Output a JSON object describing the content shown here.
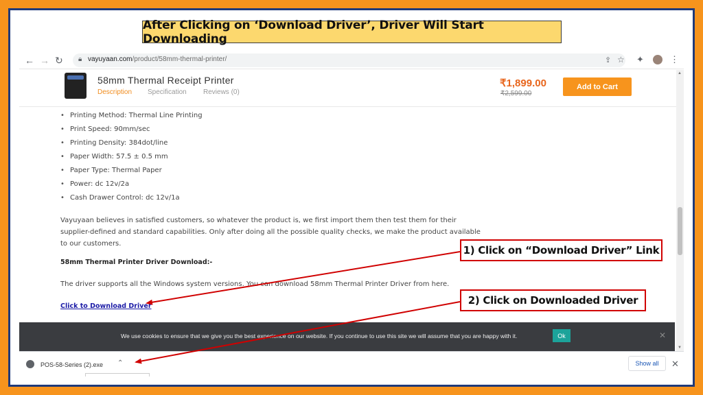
{
  "banner": {
    "title": "After Clicking on ‘Download Driver’, Driver Will Start Downloading"
  },
  "browser": {
    "url_domain": "vayuyaan.com",
    "url_path": "/product/58mm-thermal-printer/"
  },
  "product": {
    "title": "58mm Thermal Receipt Printer",
    "tabs": [
      {
        "label": "Description",
        "active": true
      },
      {
        "label": "Specification",
        "active": false
      },
      {
        "label": "Reviews (0)",
        "active": false
      }
    ],
    "price": "₹1,899.00",
    "old_price": "₹2,599.00",
    "cart_label": "Add to Cart"
  },
  "specs": [
    "Printing Method: Thermal Line Printing",
    "Print Speed: 90mm/sec",
    "Printing Density: 384dot/line",
    "Paper Width: 57.5 ± 0.5 mm",
    "Paper Type: Thermal Paper",
    "Power: dc 12v/2a",
    "Cash Drawer Control: dc 12v/1a"
  ],
  "paragraph": "Vayuyaan believes in satisfied customers, so whatever the product is, we first import them then test them for their supplier-defined and standard capabilities. Only after doing all the possible quality checks, we make the product available to our customers.",
  "download_section": {
    "heading": "58mm Thermal Printer Driver Download:-",
    "description": "The driver supports all the Windows system versions. You can download 58mm Thermal Printer Driver from here.",
    "link_text": "Click to Download Driver"
  },
  "cookie": {
    "text": "We use cookies to ensure that we give you the best experience on our website. If you continue to use this site we will assume that you are happy with it.",
    "ok_label": "Ok",
    "close_glyph": "✕"
  },
  "download_bar": {
    "file_name": "POS-58-Series (2).exe",
    "show_all_label": "Show all",
    "close_glyph": "✕"
  },
  "callouts": {
    "step1": "1) Click on “Download Driver” Link",
    "step2": "2) Click on Downloaded Driver"
  },
  "colors": {
    "frame_orange": "#f7941d",
    "frame_blue": "#1f3a7a",
    "banner_yellow": "#fcd86e",
    "price_orange": "#e8651c",
    "callout_red": "#d00000",
    "ok_teal": "#1ca39a"
  },
  "icons": [
    "back-arrow-icon",
    "forward-arrow-icon",
    "reload-icon",
    "lock-icon",
    "share-icon",
    "star-icon",
    "extensions-icon",
    "profile-avatar",
    "kebab-menu-icon",
    "printer-image",
    "file-icon",
    "chevron-up-icon",
    "close-icon"
  ]
}
